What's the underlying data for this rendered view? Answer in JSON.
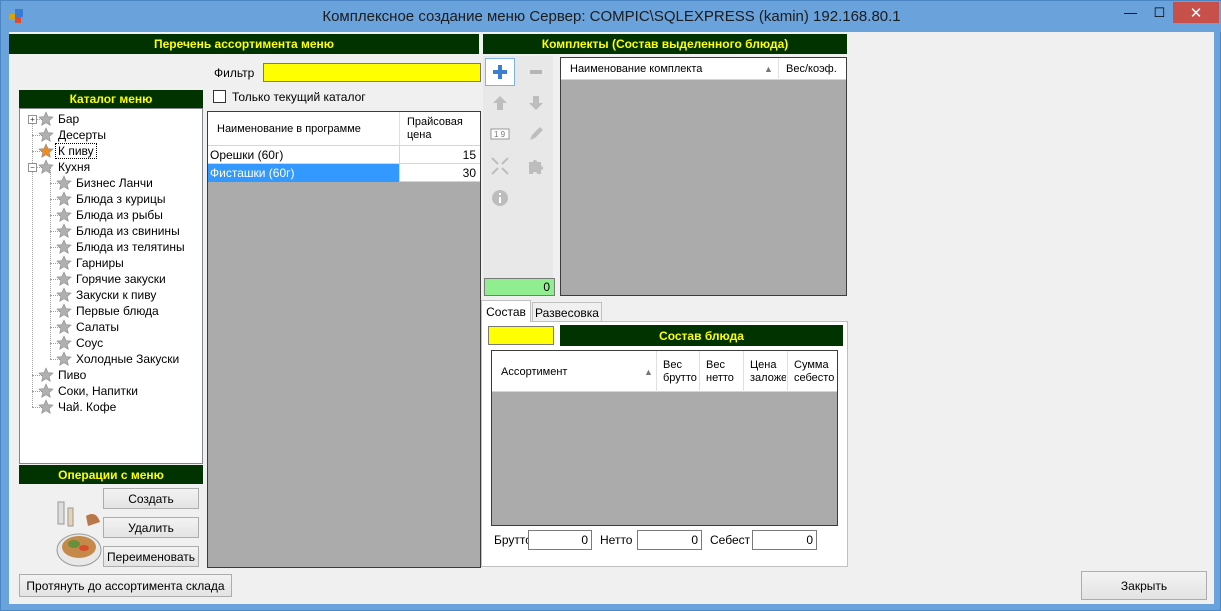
{
  "window": {
    "title": "Комплексное создание меню  Сервер: COMPIC\\SQLEXPRESS (kamin) 192.168.80.1",
    "minimize": "—",
    "maximize": "☐",
    "close": "✕"
  },
  "assortment": {
    "header": "Перечень ассортимента меню",
    "filter_label": "Фильтр",
    "filter_value": "",
    "current_catalog_only": "Только текущий каталог",
    "columns": [
      "Наименование в программе",
      "Прайсовая цена"
    ],
    "rows": [
      {
        "name": "Орешки (60г)",
        "price": "15"
      },
      {
        "name": "Фисташки (60г)",
        "price": "30"
      }
    ]
  },
  "catalog": {
    "header": "Каталог меню",
    "items": [
      {
        "label": "Бар",
        "level": 0
      },
      {
        "label": "Десерты",
        "level": 0
      },
      {
        "label": "К пиву",
        "level": 0
      },
      {
        "label": "Кухня",
        "level": 0
      },
      {
        "label": "Бизнес Ланчи",
        "level": 1
      },
      {
        "label": "Блюда з  курицы",
        "level": 1
      },
      {
        "label": "Блюда из рыбы",
        "level": 1
      },
      {
        "label": "Блюда из свинины",
        "level": 1
      },
      {
        "label": "Блюда из телятины",
        "level": 1
      },
      {
        "label": "Гарниры",
        "level": 1
      },
      {
        "label": "Горячие закуски",
        "level": 1
      },
      {
        "label": "Закуски к пиву",
        "level": 1
      },
      {
        "label": "Первые блюда",
        "level": 1
      },
      {
        "label": "Салаты",
        "level": 1
      },
      {
        "label": "Соус",
        "level": 1
      },
      {
        "label": "Холодные Закуски",
        "level": 1
      },
      {
        "label": "Пиво",
        "level": 0
      },
      {
        "label": "Соки, Напитки",
        "level": 0
      },
      {
        "label": "Чай. Кофе",
        "level": 0
      }
    ],
    "expand_plus": "+",
    "expand_minus": "−"
  },
  "operations": {
    "header": "Операции с меню",
    "create": "Создать",
    "delete": "Удалить",
    "rename": "Переименовать"
  },
  "complex": {
    "header": "Комплекты (Состав выделенного блюда)",
    "columns": [
      "Наименование комплекта",
      "Вес/коэф."
    ],
    "counter": "0"
  },
  "composition": {
    "tabs": [
      "Состав",
      "Развесовка"
    ],
    "header": "Состав блюда",
    "columns": [
      "Ассортимент",
      "Вес брутто",
      "Вес нетто",
      "Цена заложе",
      "Сумма себесто"
    ],
    "brutto_label": "Брутто",
    "brutto_value": "0",
    "netto_label": "Нетто",
    "netto_value": "0",
    "cost_label": "Себест",
    "cost_value": "0"
  },
  "footer": {
    "stretch": "Протянуть до ассортимента склада",
    "close": "Закрыть"
  },
  "colors": {
    "header_bg": "#003300",
    "header_fg": "#ffff00",
    "filter_bg": "#ffff00",
    "counter_bg": "#90ee90",
    "selection": "#3399ff"
  }
}
